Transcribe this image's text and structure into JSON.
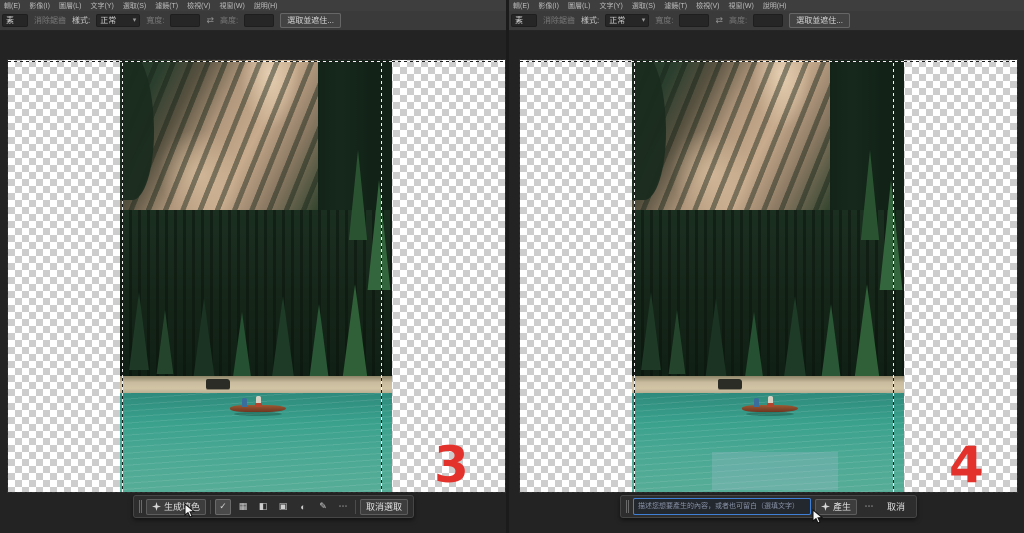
{
  "menus": [
    "輯(E)",
    "影像(I)",
    "圖層(L)",
    "文字(Y)",
    "選取(S)",
    "濾鏡(T)",
    "檢視(V)",
    "視窗(W)",
    "說明(H)"
  ],
  "options": {
    "feather_value": "素",
    "anti_alias_label": "消除鋸齒",
    "style_label": "樣式:",
    "style_value": "正常",
    "width_label": "寬度:",
    "width_value": "",
    "height_label": "高度:",
    "height_value": "",
    "select_and_mask_label": "選取並遮住..."
  },
  "icons": {
    "dropdown_arrow": "▾",
    "link_dimensions": "⇄",
    "brush_check": "✓",
    "add_selection": "▦",
    "transform_selection": "◧",
    "fill_selection": "▣",
    "mask_selection": "◐",
    "refine_edge": "✎",
    "more": "⋯"
  },
  "panel_left": {
    "step_number": "3",
    "taskbar": {
      "generative_fill_label": "生成填色",
      "deselect_label": "取消選取"
    }
  },
  "panel_right": {
    "step_number": "4",
    "taskbar": {
      "prompt_placeholder": "描述您想要產生的內容，或者也可留白（選填文字）",
      "generate_label": "產生",
      "cancel_label": "取消"
    }
  },
  "colors": {
    "accent_red": "#e3312b",
    "prompt_focus_blue": "#3f7fd6",
    "water_teal": "#3aa18d",
    "taskbar_bg": "#2d2d2d"
  }
}
